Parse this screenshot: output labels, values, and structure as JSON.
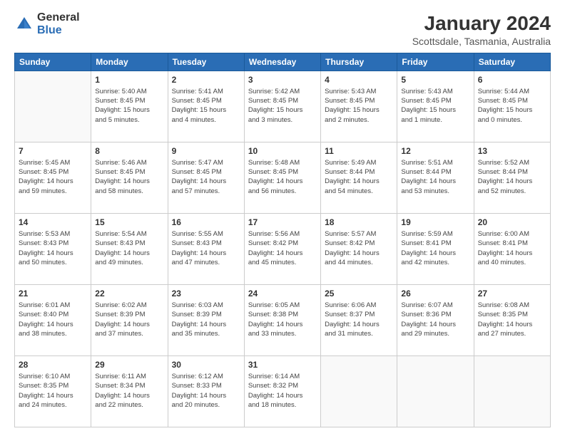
{
  "header": {
    "logo_general": "General",
    "logo_blue": "Blue",
    "month_year": "January 2024",
    "location": "Scottsdale, Tasmania, Australia"
  },
  "days_of_week": [
    "Sunday",
    "Monday",
    "Tuesday",
    "Wednesday",
    "Thursday",
    "Friday",
    "Saturday"
  ],
  "weeks": [
    [
      {
        "day": "",
        "info": ""
      },
      {
        "day": "1",
        "info": "Sunrise: 5:40 AM\nSunset: 8:45 PM\nDaylight: 15 hours\nand 5 minutes."
      },
      {
        "day": "2",
        "info": "Sunrise: 5:41 AM\nSunset: 8:45 PM\nDaylight: 15 hours\nand 4 minutes."
      },
      {
        "day": "3",
        "info": "Sunrise: 5:42 AM\nSunset: 8:45 PM\nDaylight: 15 hours\nand 3 minutes."
      },
      {
        "day": "4",
        "info": "Sunrise: 5:43 AM\nSunset: 8:45 PM\nDaylight: 15 hours\nand 2 minutes."
      },
      {
        "day": "5",
        "info": "Sunrise: 5:43 AM\nSunset: 8:45 PM\nDaylight: 15 hours\nand 1 minute."
      },
      {
        "day": "6",
        "info": "Sunrise: 5:44 AM\nSunset: 8:45 PM\nDaylight: 15 hours\nand 0 minutes."
      }
    ],
    [
      {
        "day": "7",
        "info": "Sunrise: 5:45 AM\nSunset: 8:45 PM\nDaylight: 14 hours\nand 59 minutes."
      },
      {
        "day": "8",
        "info": "Sunrise: 5:46 AM\nSunset: 8:45 PM\nDaylight: 14 hours\nand 58 minutes."
      },
      {
        "day": "9",
        "info": "Sunrise: 5:47 AM\nSunset: 8:45 PM\nDaylight: 14 hours\nand 57 minutes."
      },
      {
        "day": "10",
        "info": "Sunrise: 5:48 AM\nSunset: 8:45 PM\nDaylight: 14 hours\nand 56 minutes."
      },
      {
        "day": "11",
        "info": "Sunrise: 5:49 AM\nSunset: 8:44 PM\nDaylight: 14 hours\nand 54 minutes."
      },
      {
        "day": "12",
        "info": "Sunrise: 5:51 AM\nSunset: 8:44 PM\nDaylight: 14 hours\nand 53 minutes."
      },
      {
        "day": "13",
        "info": "Sunrise: 5:52 AM\nSunset: 8:44 PM\nDaylight: 14 hours\nand 52 minutes."
      }
    ],
    [
      {
        "day": "14",
        "info": "Sunrise: 5:53 AM\nSunset: 8:43 PM\nDaylight: 14 hours\nand 50 minutes."
      },
      {
        "day": "15",
        "info": "Sunrise: 5:54 AM\nSunset: 8:43 PM\nDaylight: 14 hours\nand 49 minutes."
      },
      {
        "day": "16",
        "info": "Sunrise: 5:55 AM\nSunset: 8:43 PM\nDaylight: 14 hours\nand 47 minutes."
      },
      {
        "day": "17",
        "info": "Sunrise: 5:56 AM\nSunset: 8:42 PM\nDaylight: 14 hours\nand 45 minutes."
      },
      {
        "day": "18",
        "info": "Sunrise: 5:57 AM\nSunset: 8:42 PM\nDaylight: 14 hours\nand 44 minutes."
      },
      {
        "day": "19",
        "info": "Sunrise: 5:59 AM\nSunset: 8:41 PM\nDaylight: 14 hours\nand 42 minutes."
      },
      {
        "day": "20",
        "info": "Sunrise: 6:00 AM\nSunset: 8:41 PM\nDaylight: 14 hours\nand 40 minutes."
      }
    ],
    [
      {
        "day": "21",
        "info": "Sunrise: 6:01 AM\nSunset: 8:40 PM\nDaylight: 14 hours\nand 38 minutes."
      },
      {
        "day": "22",
        "info": "Sunrise: 6:02 AM\nSunset: 8:39 PM\nDaylight: 14 hours\nand 37 minutes."
      },
      {
        "day": "23",
        "info": "Sunrise: 6:03 AM\nSunset: 8:39 PM\nDaylight: 14 hours\nand 35 minutes."
      },
      {
        "day": "24",
        "info": "Sunrise: 6:05 AM\nSunset: 8:38 PM\nDaylight: 14 hours\nand 33 minutes."
      },
      {
        "day": "25",
        "info": "Sunrise: 6:06 AM\nSunset: 8:37 PM\nDaylight: 14 hours\nand 31 minutes."
      },
      {
        "day": "26",
        "info": "Sunrise: 6:07 AM\nSunset: 8:36 PM\nDaylight: 14 hours\nand 29 minutes."
      },
      {
        "day": "27",
        "info": "Sunrise: 6:08 AM\nSunset: 8:35 PM\nDaylight: 14 hours\nand 27 minutes."
      }
    ],
    [
      {
        "day": "28",
        "info": "Sunrise: 6:10 AM\nSunset: 8:35 PM\nDaylight: 14 hours\nand 24 minutes."
      },
      {
        "day": "29",
        "info": "Sunrise: 6:11 AM\nSunset: 8:34 PM\nDaylight: 14 hours\nand 22 minutes."
      },
      {
        "day": "30",
        "info": "Sunrise: 6:12 AM\nSunset: 8:33 PM\nDaylight: 14 hours\nand 20 minutes."
      },
      {
        "day": "31",
        "info": "Sunrise: 6:14 AM\nSunset: 8:32 PM\nDaylight: 14 hours\nand 18 minutes."
      },
      {
        "day": "",
        "info": ""
      },
      {
        "day": "",
        "info": ""
      },
      {
        "day": "",
        "info": ""
      }
    ]
  ]
}
